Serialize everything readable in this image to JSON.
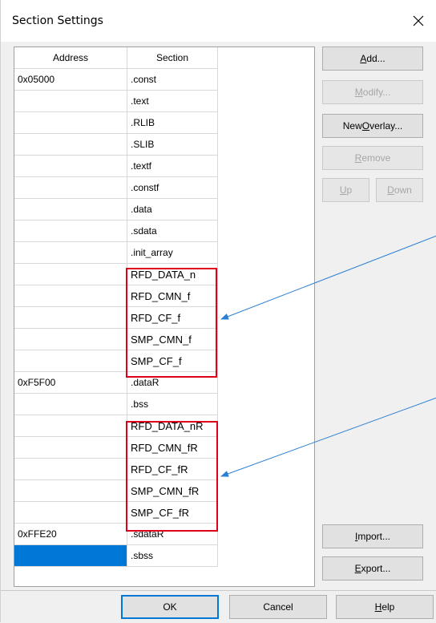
{
  "window": {
    "title": "Section Settings",
    "close_glyph": "✕"
  },
  "table": {
    "headers": {
      "address": "Address",
      "section": "Section"
    },
    "rows": [
      {
        "address": "0x05000",
        "section": ".const"
      },
      {
        "address": "",
        "section": ".text"
      },
      {
        "address": "",
        "section": ".RLIB"
      },
      {
        "address": "",
        "section": ".SLIB"
      },
      {
        "address": "",
        "section": ".textf"
      },
      {
        "address": "",
        "section": ".constf"
      },
      {
        "address": "",
        "section": ".data"
      },
      {
        "address": "",
        "section": ".sdata"
      },
      {
        "address": "",
        "section": ".init_array"
      },
      {
        "address": "",
        "section": "RFD_DATA_n"
      },
      {
        "address": "",
        "section": "RFD_CMN_f"
      },
      {
        "address": "",
        "section": "RFD_CF_f"
      },
      {
        "address": "",
        "section": "SMP_CMN_f"
      },
      {
        "address": "",
        "section": "SMP_CF_f"
      },
      {
        "address": "0xF5F00",
        "section": ".dataR"
      },
      {
        "address": "",
        "section": ".bss"
      },
      {
        "address": "",
        "section": "RFD_DATA_nR"
      },
      {
        "address": "",
        "section": "RFD_CMN_fR"
      },
      {
        "address": "",
        "section": "RFD_CF_fR"
      },
      {
        "address": "",
        "section": "SMP_CMN_fR"
      },
      {
        "address": "",
        "section": "SMP_CF_fR"
      },
      {
        "address": "0xFFE20",
        "section": ".sdataR"
      },
      {
        "address": "",
        "section": ".sbss"
      }
    ]
  },
  "buttons": {
    "add": {
      "pre": "",
      "key": "A",
      "post": "dd..."
    },
    "modify": {
      "pre": "",
      "key": "M",
      "post": "odify..."
    },
    "new_overlay": {
      "pre": "New ",
      "key": "O",
      "post": "verlay..."
    },
    "remove": {
      "pre": "",
      "key": "R",
      "post": "emove"
    },
    "up": {
      "pre": "",
      "key": "U",
      "post": "p"
    },
    "down": {
      "pre": "",
      "key": "D",
      "post": "own"
    },
    "import": {
      "pre": "",
      "key": "I",
      "post": "mport..."
    },
    "export": {
      "pre": "",
      "key": "E",
      "post": "xport..."
    },
    "ok": "OK",
    "cancel": "Cancel",
    "help": {
      "pre": "",
      "key": "H",
      "post": "elp"
    }
  },
  "colors": {
    "highlight_box": "#e0001b",
    "arrow": "#2a7fd4",
    "selection": "#0078d7"
  }
}
